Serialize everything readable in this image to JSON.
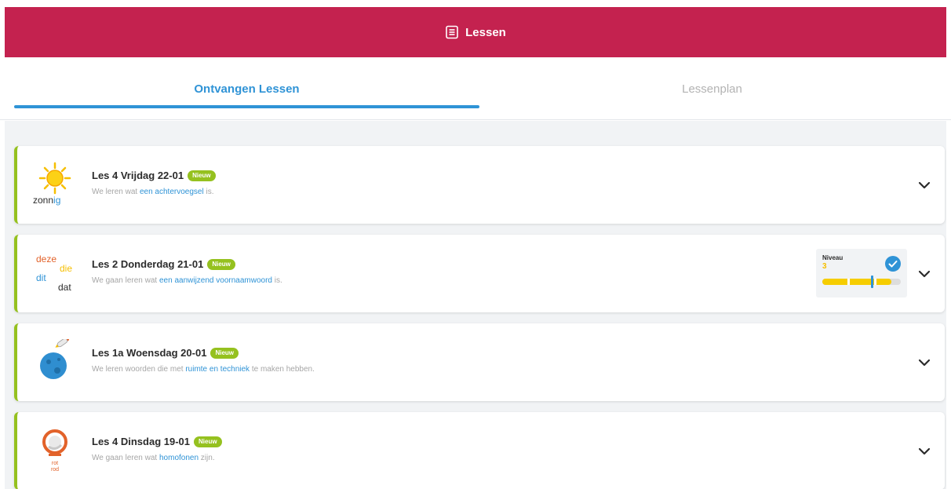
{
  "header": {
    "title": "Lessen",
    "icon": "list-icon",
    "color": "#c4224f"
  },
  "tabs": [
    {
      "label": "Ontvangen Lessen",
      "active": true
    },
    {
      "label": "Lessenplan",
      "active": false
    }
  ],
  "lessons": [
    {
      "title": "Les 4 Vrijdag 22-01",
      "badge": "Nieuw",
      "desc_before": "We leren wat ",
      "desc_highlight": "een achtervoegsel",
      "desc_after": " is.",
      "thumb_icon": "sun-zonnig-icon",
      "thumb_word_a": "zonn",
      "thumb_word_b": "ig"
    },
    {
      "title": "Les 2 Donderdag 21-01",
      "badge": "Nieuw",
      "desc_before": "We gaan leren wat ",
      "desc_highlight": "een aanwijzend voornaamwoord",
      "desc_after": " is.",
      "thumb_icon": "deze-die-dit-dat-icon",
      "thumb_words": [
        "deze",
        "die",
        "dit",
        "dat"
      ],
      "niveau": {
        "label": "Niveau",
        "value": "3",
        "completed": true,
        "progress": 0.88,
        "marker": 0.62
      }
    },
    {
      "title": "Les 1a Woensdag 20-01",
      "badge": "Nieuw",
      "desc_before": "We leren woorden die met ",
      "desc_highlight": "ruimte en techniek",
      "desc_after": " te maken hebben.",
      "thumb_icon": "planet-rocket-icon"
    },
    {
      "title": "Les 4 Dinsdag 19-01",
      "badge": "Nieuw",
      "desc_before": "We gaan leren wat ",
      "desc_highlight": "homofonen",
      "desc_after": " zijn.",
      "thumb_icon": "rot-rod-icon",
      "thumb_words": [
        "rot",
        "rod"
      ]
    }
  ],
  "colors": {
    "accent": "#2f93d6",
    "badge": "#95c11f",
    "niveau": "#f6bf00"
  }
}
